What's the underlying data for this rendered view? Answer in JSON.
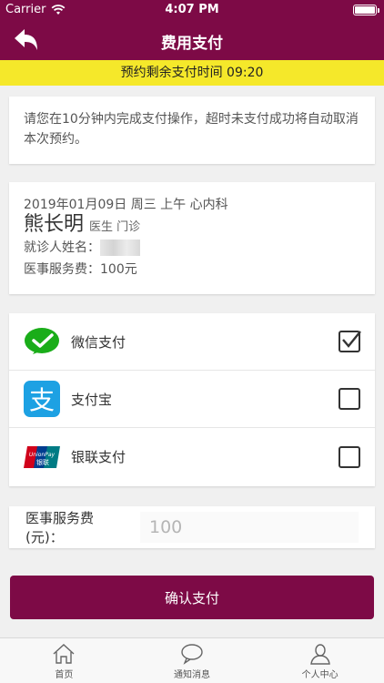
{
  "status_bar": {
    "carrier": "Carrier",
    "time": "4:07 PM"
  },
  "nav": {
    "title": "费用支付"
  },
  "timer": {
    "text": "预约剩余支付时间 09:20"
  },
  "notice": {
    "text": "请您在10分钟内完成支付操作，超时未支付成功将自动取消本次预约。"
  },
  "appointment": {
    "date": "2019年01月09日 周三 上午 心内科",
    "doctor_name": "熊长明",
    "doctor_title": "医生 门诊",
    "patient_label": "就诊人姓名：",
    "fee_label": "医事服务费：",
    "fee_value": "100元"
  },
  "payment_methods": [
    {
      "label": "微信支付",
      "icon": "wechat-icon",
      "checked": true,
      "color": "#1aad19"
    },
    {
      "label": "支付宝",
      "icon": "alipay-icon",
      "checked": false,
      "color": "#1da1e3"
    },
    {
      "label": "银联支付",
      "icon": "unionpay-icon",
      "checked": false,
      "color": "#d0021b"
    }
  ],
  "fee_input": {
    "label": "医事服务费(元)：",
    "placeholder": "100"
  },
  "confirm_button": {
    "label": "确认支付"
  },
  "tabs": [
    {
      "label": "首页",
      "icon": "home-icon"
    },
    {
      "label": "通知消息",
      "icon": "message-icon"
    },
    {
      "label": "个人中心",
      "icon": "user-icon"
    }
  ],
  "colors": {
    "primary": "#7d0a46",
    "timer_bg": "#f5e82a"
  }
}
